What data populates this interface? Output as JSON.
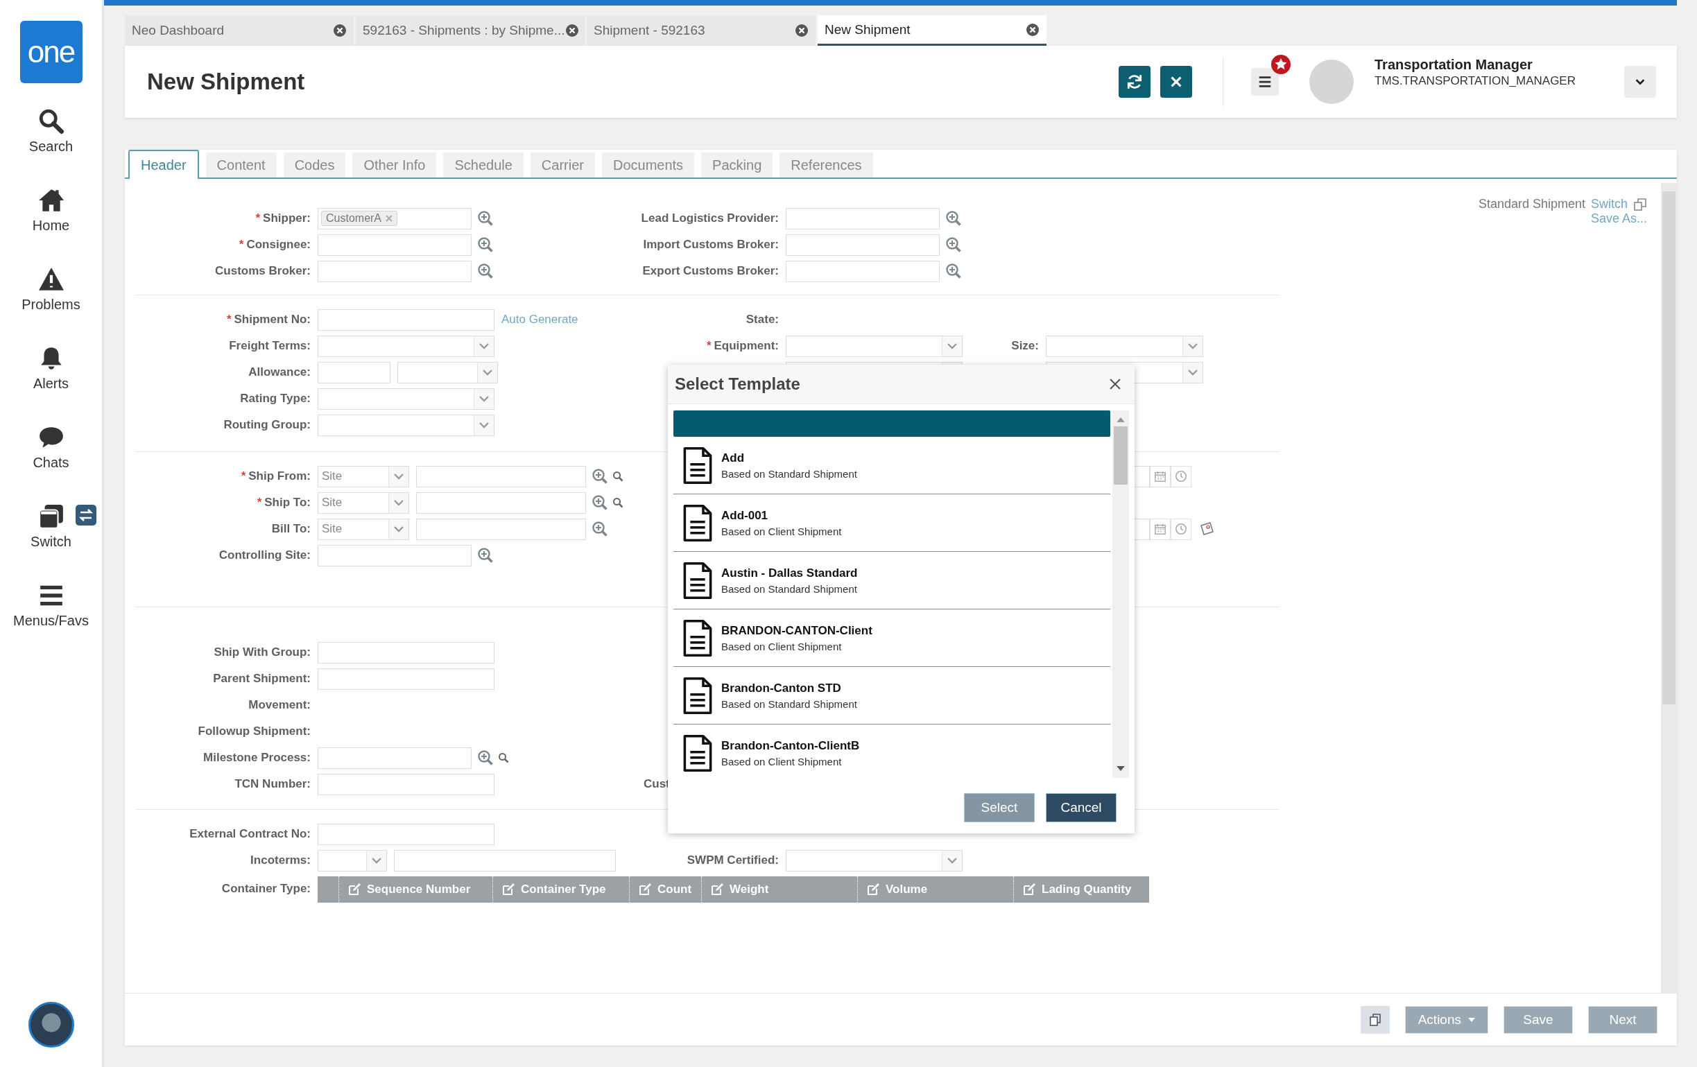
{
  "sidebar": {
    "logo": "one",
    "items": [
      {
        "label": "Search"
      },
      {
        "label": "Home"
      },
      {
        "label": "Problems"
      },
      {
        "label": "Alerts"
      },
      {
        "label": "Chats"
      },
      {
        "label": "Switch"
      },
      {
        "label": "Menus/Favs"
      }
    ]
  },
  "tabs": [
    {
      "label": "Neo Dashboard",
      "selected": false
    },
    {
      "label": "592163 - Shipments : by Shipme...",
      "selected": false
    },
    {
      "label": "Shipment - 592163",
      "selected": false
    },
    {
      "label": "New Shipment",
      "selected": true
    }
  ],
  "header": {
    "title": "New Shipment",
    "user_name": "Transportation Manager",
    "user_role": "TMS.TRANSPORTATION_MANAGER"
  },
  "form_tabs": [
    {
      "label": "Header",
      "selected": true
    },
    {
      "label": "Content",
      "selected": false
    },
    {
      "label": "Codes",
      "selected": false
    },
    {
      "label": "Other Info",
      "selected": false
    },
    {
      "label": "Schedule",
      "selected": false
    },
    {
      "label": "Carrier",
      "selected": false
    },
    {
      "label": "Documents",
      "selected": false
    },
    {
      "label": "Packing",
      "selected": false
    },
    {
      "label": "References",
      "selected": false
    }
  ],
  "template_info": {
    "name": "Standard Shipment",
    "switch_link": "Switch",
    "save_as_link": "Save As..."
  },
  "sections": [
    {
      "left": [
        {
          "required_mark": "*",
          "label": "Shipper:",
          "kind": "lookup",
          "chip": "CustomerA"
        },
        {
          "required_mark": "*",
          "label": "Consignee:",
          "kind": "lookup"
        },
        {
          "label": "Customs Broker:",
          "kind": "lookup"
        }
      ],
      "middle": [
        {
          "label": "Lead Logistics Provider:",
          "kind": "lookup"
        },
        {
          "label": "Import Customs Broker:",
          "kind": "lookup"
        },
        {
          "label": "Export Customs Broker:",
          "kind": "lookup"
        }
      ]
    },
    {
      "left": [
        {
          "required_mark": "*",
          "label": "Shipment No:",
          "kind": "text",
          "link": "Auto Generate"
        },
        {
          "label": "Freight Terms:",
          "kind": "select"
        },
        {
          "label": "Allowance:",
          "kind": "split"
        },
        {
          "label": "Rating Type:",
          "kind": "select"
        },
        {
          "label": "Routing Group:",
          "kind": "select"
        }
      ],
      "middle": [
        {
          "label": "State:",
          "kind": "none"
        },
        {
          "required_mark": "*",
          "label": "Equipment:",
          "kind": "select"
        },
        {
          "kind": "select"
        }
      ],
      "right": [
        {
          "label": "Size:",
          "kind": "select"
        },
        {
          "kind": "select"
        }
      ]
    },
    {
      "left": [
        {
          "required_mark": "*",
          "label": "Ship From:",
          "kind": "site",
          "value": "Site",
          "search_icon": true
        },
        {
          "required_mark": "*",
          "label": "Ship To:",
          "kind": "site",
          "value": "Site",
          "search_icon": true
        },
        {
          "label": "Bill To:",
          "kind": "site",
          "value": "Site",
          "search_icon": false
        },
        {
          "label": "Controlling Site:",
          "kind": "lookup"
        }
      ],
      "right": [
        {
          "kind": "datetime",
          "note_icon": false
        },
        {
          "kind": "datetime",
          "note_icon": true
        }
      ]
    },
    {
      "left": [
        {
          "label": "Ship With Group:",
          "kind": "text"
        },
        {
          "label": "Parent Shipment:",
          "kind": "text"
        },
        {
          "label": "Movement:",
          "kind": "none"
        },
        {
          "label": "Followup Shipment:",
          "kind": "none"
        },
        {
          "label": "Milestone Process:",
          "kind": "lookup_search"
        },
        {
          "label": "TCN Number:",
          "kind": "text"
        }
      ],
      "middle": [
        {
          "label": "Cust",
          "kind": "none",
          "cut": true
        }
      ]
    },
    {
      "left": [
        {
          "label": "External Contract No:",
          "kind": "text"
        },
        {
          "label": "Incoterms:",
          "kind": "incoterms"
        }
      ],
      "middle": [
        {
          "label": "SWPM Certified:",
          "kind": "select"
        }
      ],
      "container_grid": {
        "label": "Container Type:",
        "columns": [
          "Sequence Number",
          "Container Type",
          "Count",
          "Weight",
          "Volume",
          "Lading Quantity"
        ]
      }
    }
  ],
  "footer_buttons": [
    {
      "label": "Actions",
      "kind": "menu"
    },
    {
      "label": "Save",
      "kind": "plain"
    },
    {
      "label": "Next",
      "kind": "plain"
    }
  ],
  "modal": {
    "title": "Select Template",
    "templates": [
      {
        "name": "Add",
        "based_on": "Based on Standard Shipment"
      },
      {
        "name": "Add-001",
        "based_on": "Based on Client Shipment"
      },
      {
        "name": "Austin - Dallas Standard",
        "based_on": "Based on Standard Shipment"
      },
      {
        "name": "BRANDON-CANTON-Client",
        "based_on": "Based on Client Shipment"
      },
      {
        "name": "Brandon-Canton STD",
        "based_on": "Based on Standard Shipment"
      },
      {
        "name": "Brandon-Canton-ClientB",
        "based_on": "Based on Client Shipment"
      }
    ],
    "buttons": [
      {
        "label": "Select",
        "disabled": true
      },
      {
        "label": "Cancel",
        "disabled": false
      }
    ]
  }
}
